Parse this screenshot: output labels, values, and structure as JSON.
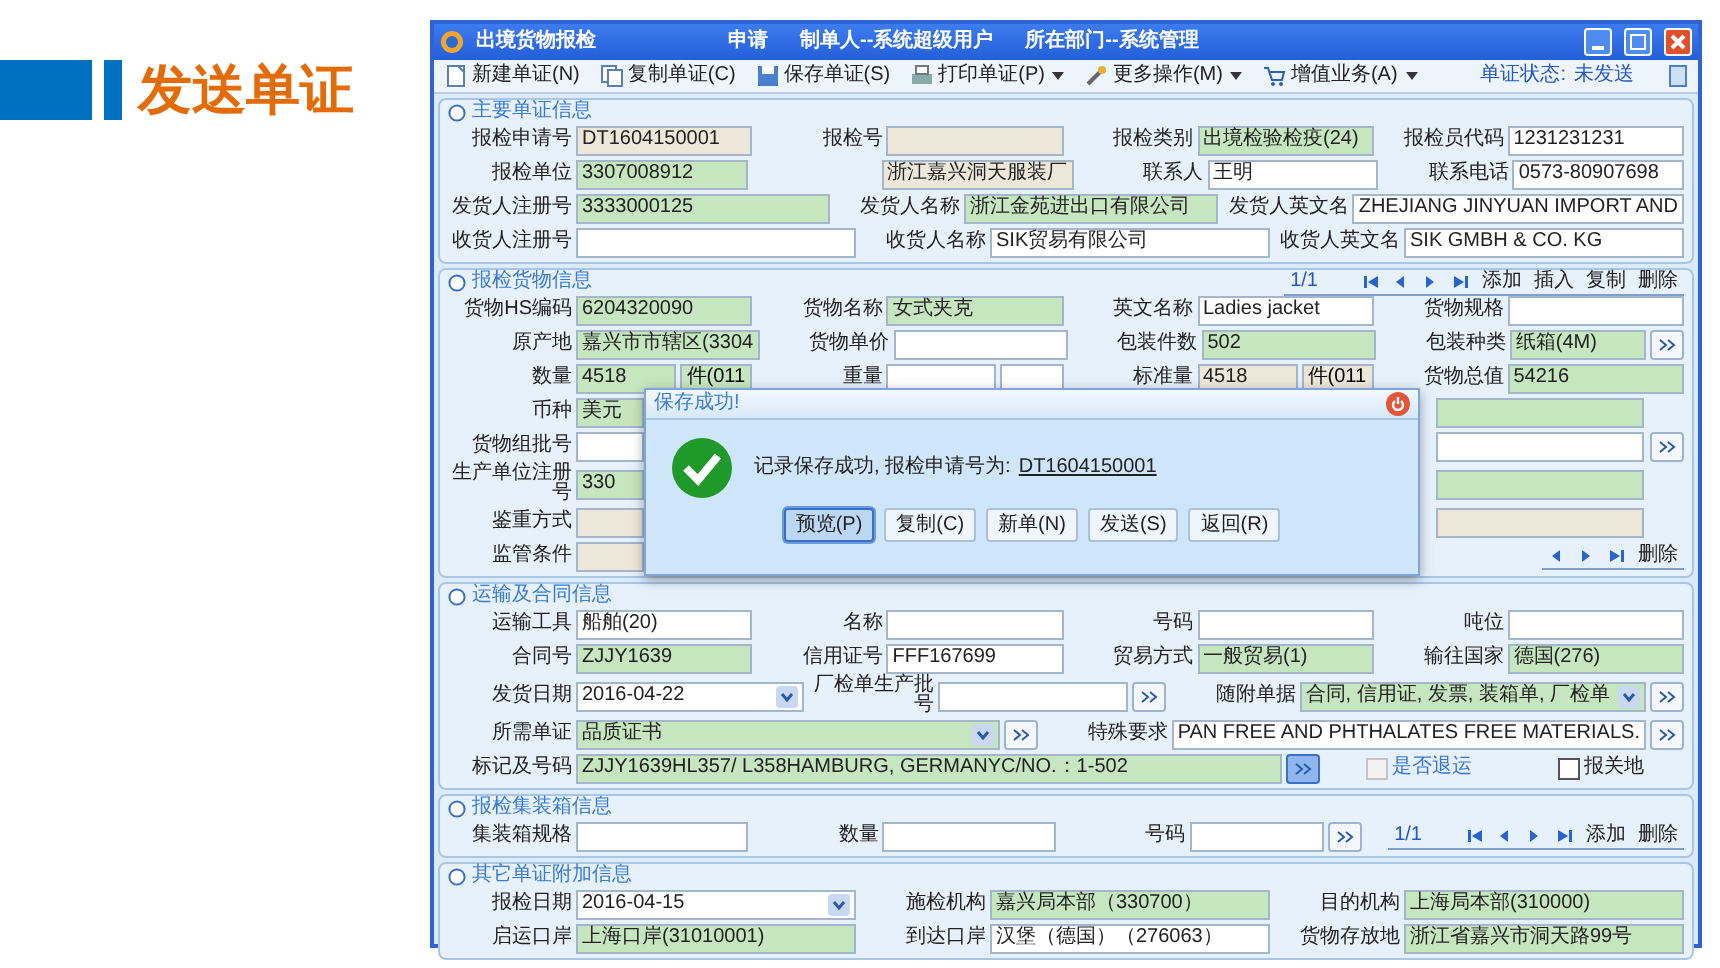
{
  "slide_title": "发送单证",
  "window": {
    "title": "出境货物报检",
    "header_parts": [
      "申请",
      "制单人--系统超级用户",
      "所在部门--系统管理"
    ]
  },
  "toolbar": [
    {
      "kind": "new",
      "label": "新建单证(N)",
      "menu": false
    },
    {
      "kind": "copy",
      "label": "复制单证(C)",
      "menu": false
    },
    {
      "kind": "save",
      "label": "保存单证(S)",
      "menu": false
    },
    {
      "kind": "print",
      "label": "打印单证(P)",
      "menu": true
    },
    {
      "kind": "tools",
      "label": "更多操作(M)",
      "menu": true
    },
    {
      "kind": "cart",
      "label": "增值业务(A)",
      "menu": true
    }
  ],
  "status": {
    "label": "单证状态:",
    "value": "未发送"
  },
  "sections": [
    {
      "title": "主要单证信息",
      "rows": [
        {
          "items": [
            {
              "label": "报检申请号",
              "value": "DT1604150001",
              "color": "#ece7d9"
            },
            {
              "label": "报检号",
              "color": "#ece7d9"
            },
            {
              "label": "报检类别",
              "value": "出境检验检疫(24)",
              "color": "#c6e6bf"
            },
            {
              "label": "报检员代码",
              "value": "1231231231",
              "color": "#ffffff"
            }
          ]
        },
        {
          "items": [
            {
              "label": "报检单位",
              "value": "3307008912",
              "color": "#c6e6bf"
            },
            {
              "value": "浙江嘉兴洞天服装厂",
              "color": "#ece7d9"
            },
            {
              "label": "联系人",
              "value": "王明",
              "color": "#ffffff"
            },
            {
              "label": "联系电话",
              "value": "0573-80907698",
              "color": "#ffffff"
            }
          ]
        },
        {
          "items": [
            {
              "label": "发货人注册号",
              "value": "3333000125",
              "color": "#c6e6bf"
            },
            {
              "label": "发货人名称",
              "value": "浙江金苑进出口有限公司",
              "color": "#c6e6bf"
            },
            {
              "label": "发货人英文名",
              "value": "ZHEJIANG JINYUAN IMPORT AND",
              "color": "#ffffff"
            }
          ]
        },
        {
          "items": [
            {
              "label": "收货人注册号",
              "color": "#ffffff"
            },
            {
              "label": "收货人名称",
              "value": "SIK贸易有限公司",
              "color": "#ffffff"
            },
            {
              "label": "收货人英文名",
              "value": "SIK GMBH & CO. KG",
              "color": "#ffffff"
            }
          ]
        }
      ]
    },
    {
      "title": "报检货物信息",
      "pager": {
        "position": "1/1",
        "nav": [
          {
            "kind": "first"
          },
          {
            "kind": "prev"
          },
          {
            "kind": "next"
          },
          {
            "kind": "last"
          }
        ],
        "actions": [
          "添加",
          "插入",
          "复制",
          "删除"
        ]
      },
      "rows": [
        {
          "items": [
            {
              "label": "货物HS编码",
              "value": "6204320090",
              "color": "#c6e6bf"
            },
            {
              "label": "货物名称",
              "value": "女式夹克",
              "color": "#c6e6bf"
            },
            {
              "label": "英文名称",
              "value": "Ladies jacket",
              "color": "#ffffff"
            },
            {
              "label": "货物规格",
              "color": "#ffffff"
            }
          ]
        },
        {
          "items": [
            {
              "label": "原产地",
              "value": "嘉兴市市辖区(3304",
              "color": "#c6e6bf"
            },
            {
              "label": "货物单价",
              "color": "#ffffff"
            },
            {
              "label": "包装件数",
              "value": "502",
              "color": "#c6e6bf"
            },
            {
              "label": "包装种类",
              "value": "纸箱(4M)",
              "color": "#c6e6bf",
              "more": true
            }
          ]
        },
        {
          "items": [
            {
              "label": "数量",
              "value": "4518",
              "color": "#c6e6bf",
              "unit": "件(011"
            },
            {
              "label": "重量",
              "color": "#ffffff",
              "blank_unit": true
            },
            {
              "label": "标准量",
              "value": "4518",
              "color": "#ece7d9",
              "unit": "件(011"
            },
            {
              "label": "货物总值",
              "value": "54216",
              "color": "#c6e6bf"
            }
          ]
        },
        {
          "covered": true,
          "items": [
            {
              "label": "币种",
              "value": "美元",
              "color": "#c6e6bf"
            },
            {
              "color": "#c6e6bf"
            }
          ]
        },
        {
          "covered": true,
          "items": [
            {
              "label": "货物组批号",
              "color": "#ffffff"
            },
            {
              "color": "#ffffff",
              "more": true
            }
          ]
        },
        {
          "covered": true,
          "items": [
            {
              "label": "生产单位注册号",
              "value": "330",
              "color": "#c6e6bf"
            },
            {
              "color": "#c6e6bf"
            }
          ]
        },
        {
          "covered": true,
          "items": [
            {
              "label": "鉴重方式",
              "color": "#ece7d9"
            },
            {
              "color": "#ece7d9"
            }
          ]
        },
        {
          "covered": true,
          "items": [
            {
              "label": "监管条件",
              "color": "#ece7d9"
            },
            {
              "kind": "pager",
              "nav": [
                {
                  "kind": "prev"
                },
                {
                  "kind": "next"
                },
                {
                  "kind": "last"
                }
              ],
              "actions": [
                "删除"
              ]
            }
          ]
        }
      ]
    },
    {
      "title": "运输及合同信息",
      "rows": [
        {
          "items": [
            {
              "label": "运输工具",
              "value": "船舶(20)",
              "color": "#ffffff"
            },
            {
              "label": "名称",
              "color": "#ffffff"
            },
            {
              "label": "号码",
              "color": "#ffffff"
            },
            {
              "label": "吨位",
              "color": "#ffffff"
            }
          ]
        },
        {
          "items": [
            {
              "label": "合同号",
              "value": "ZJJY1639",
              "color": "#c6e6bf"
            },
            {
              "label": "信用证号",
              "value": "FFF167699",
              "color": "#ffffff"
            },
            {
              "label": "贸易方式",
              "value": "一般贸易(1)",
              "color": "#c6e6bf"
            },
            {
              "label": "输往国家",
              "value": "德国(276)",
              "color": "#c6e6bf"
            }
          ]
        },
        {
          "items": [
            {
              "label": "发货日期",
              "value": "2016-04-22",
              "color": "#ffffff",
              "dropdown": true
            },
            {
              "label": "厂检单生产批号",
              "color": "#ffffff",
              "more": true
            },
            {
              "label": "随附单据",
              "value": "合同, 信用证, 发票, 装箱单, 厂检单",
              "color": "#c6e6bf",
              "dropdown": true,
              "more": true
            }
          ]
        },
        {
          "items": [
            {
              "label": "所需单证",
              "value": "品质证书",
              "color": "#c6e6bf",
              "dropdown": true,
              "more": true
            },
            {
              "label": "特殊要求",
              "value": "PAN FREE AND PHTHALATES FREE MATERIALS.",
              "color": "#ffffff",
              "more": true
            }
          ]
        },
        {
          "items": [
            {
              "label": "标记及号码",
              "value": "ZJJY1639HL357/ L358HAMBURG, GERMANYC/NO.：1-502",
              "color": "#c6e6bf",
              "more": true,
              "focused": true
            },
            {
              "kind": "checkbox",
              "label": "是否退运",
              "checked": false,
              "disabled": true
            },
            {
              "kind": "checkbox",
              "label": "报关地",
              "checked": false,
              "disabled": false
            }
          ]
        }
      ]
    },
    {
      "title": "报检集装箱信息",
      "rows": [
        {
          "items": [
            {
              "label": "集装箱规格",
              "color": "#ffffff"
            },
            {
              "label": "数量",
              "color": "#ffffff"
            },
            {
              "label": "号码",
              "color": "#ffffff",
              "more": true
            },
            {
              "kind": "pager",
              "position": "1/1",
              "nav": [
                {
                  "kind": "first"
                },
                {
                  "kind": "prev"
                },
                {
                  "kind": "next"
                },
                {
                  "kind": "last"
                }
              ],
              "actions": [
                "添加",
                "删除"
              ]
            }
          ]
        }
      ]
    },
    {
      "title": "其它单证附加信息",
      "rows": [
        {
          "items": [
            {
              "label": "报检日期",
              "value": "2016-04-15",
              "color": "#ffffff",
              "dropdown": true
            },
            {
              "label": "施检机构",
              "value": "嘉兴局本部（330700）",
              "color": "#c6e6bf"
            },
            {
              "label": "目的机构",
              "value": "上海局本部(310000)",
              "color": "#c6e6bf"
            }
          ]
        },
        {
          "items": [
            {
              "label": "启运口岸",
              "value": "上海口岸(31010001)",
              "color": "#c6e6bf"
            },
            {
              "label": "到达口岸",
              "value": "汉堡（德国）（276063）",
              "color": "#ffffff"
            },
            {
              "label": "货物存放地",
              "value": "浙江省嘉兴市洞天路99号",
              "color": "#c6e6bf"
            }
          ]
        }
      ]
    }
  ],
  "dialog": {
    "title": "保存成功!",
    "message": "记录保存成功, 报检申请号为:",
    "number": "DT1604150001",
    "buttons": [
      {
        "label": "预览(P)",
        "selected": true
      },
      {
        "label": "复制(C)",
        "selected": false
      },
      {
        "label": "新单(N)",
        "selected": false
      },
      {
        "label": "发送(S)",
        "selected": false
      },
      {
        "label": "返回(R)",
        "selected": false
      }
    ]
  }
}
